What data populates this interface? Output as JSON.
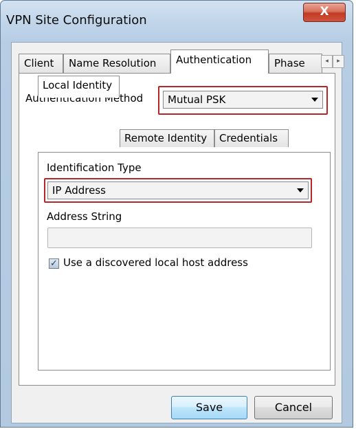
{
  "window": {
    "title": "VPN Site Configuration",
    "close_label": "X"
  },
  "tabs": [
    {
      "label": "Client"
    },
    {
      "label": "Name Resolution"
    },
    {
      "label": "Authentication"
    },
    {
      "label": "Phase"
    }
  ],
  "tab_scroll": {
    "left": "◂",
    "right": "▸"
  },
  "auth": {
    "method_label": "Authentication Method",
    "method_value": "Mutual PSK"
  },
  "subtabs": [
    {
      "label": "Local Identity"
    },
    {
      "label": "Remote Identity"
    },
    {
      "label": "Credentials"
    }
  ],
  "local_identity": {
    "id_type_label": "Identification Type",
    "id_type_value": "IP Address",
    "address_label": "Address String",
    "address_value": "",
    "checkbox_label": "Use a discovered local host address",
    "checkbox_mark": "✓"
  },
  "buttons": {
    "save": "Save",
    "cancel": "Cancel"
  },
  "colors": {
    "highlight": "#b62528",
    "accent": "#3c7fb1",
    "close": "#c23a24"
  }
}
